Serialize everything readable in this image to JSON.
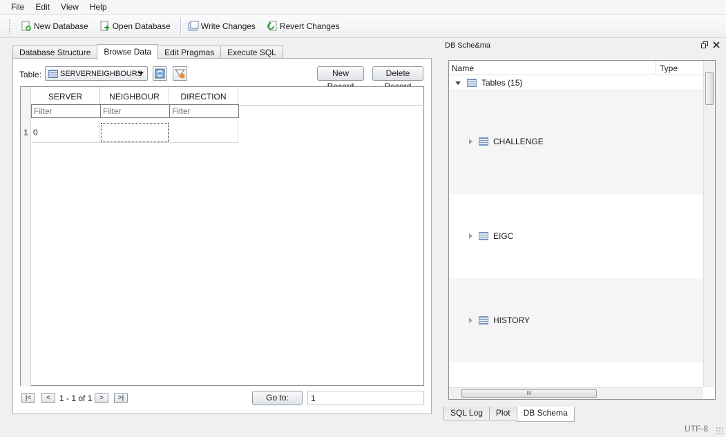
{
  "menu": [
    "File",
    "Edit",
    "View",
    "Help"
  ],
  "toolbar": {
    "new_db": "New Database",
    "open_db": "Open Database",
    "write": "Write Changes",
    "revert": "Revert Changes"
  },
  "main_tabs": [
    "Database Structure",
    "Browse Data",
    "Edit Pragmas",
    "Execute SQL"
  ],
  "active_tab": "Browse Data",
  "browse": {
    "table_label": "Table:",
    "table_selected": "SERVERNEIGHBOURS",
    "new_record": "New Record",
    "delete_record": "Delete Record",
    "columns": [
      "SERVER",
      "NEIGHBOUR",
      "DIRECTION"
    ],
    "filter_placeholder": "Filter",
    "rows": [
      {
        "num": "1",
        "cells": [
          "0",
          "",
          ""
        ]
      }
    ],
    "nav": {
      "first": "|<",
      "prev": "<",
      "next": ">",
      "last": ">|"
    },
    "page_info": "1 - 1 of 1",
    "goto_label": "Go to:",
    "goto_value": "1"
  },
  "schema": {
    "title": "DB Sche&ma",
    "col_name": "Name",
    "col_type": "Type",
    "root": "Tables (15)",
    "items": [
      "CHALLENGE",
      "EIGC",
      "HISTORY"
    ],
    "hscroll_grip": "III"
  },
  "bottom_tabs": [
    "SQL Log",
    "Plot",
    "DB Schema"
  ],
  "active_bottom_tab": "DB Schema",
  "status": {
    "encoding": "UTF-8"
  }
}
